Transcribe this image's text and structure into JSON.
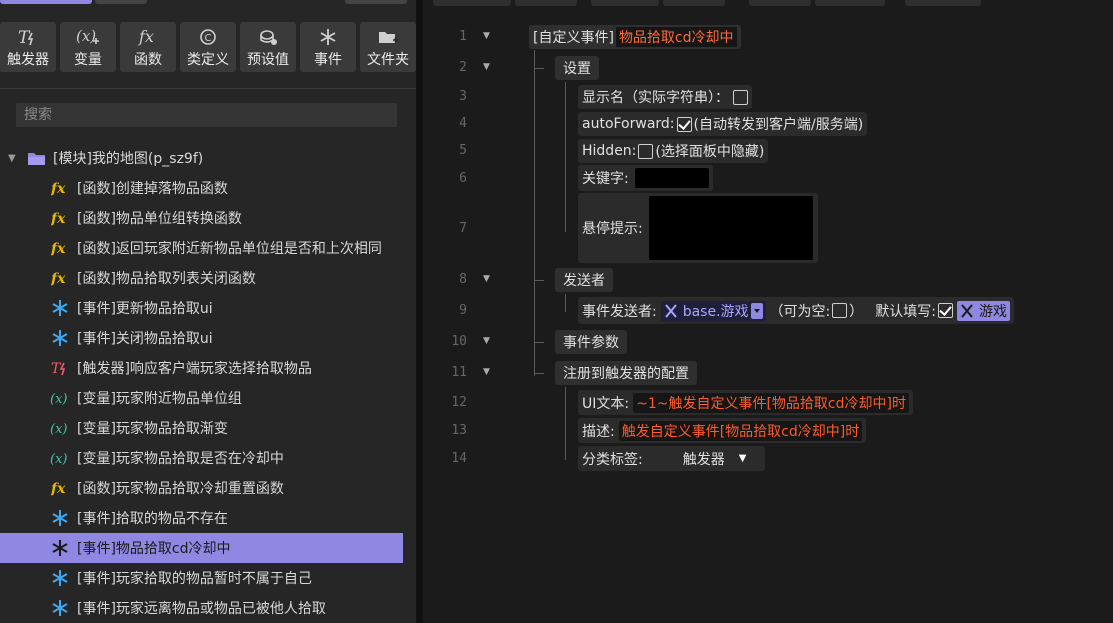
{
  "toolbar": {
    "buttons": [
      {
        "label": "触发器",
        "icon": "trigger-icon"
      },
      {
        "label": "变量",
        "icon": "variable-icon"
      },
      {
        "label": "函数",
        "icon": "function-icon"
      },
      {
        "label": "类定义",
        "icon": "class-icon"
      },
      {
        "label": "预设值",
        "icon": "preset-icon"
      },
      {
        "label": "事件",
        "icon": "event-icon"
      },
      {
        "label": "文件夹",
        "icon": "folder-add-icon"
      }
    ]
  },
  "search": {
    "placeholder": "搜索"
  },
  "tree": {
    "root": "[模块]我的地图(p_sz9f)",
    "items": [
      {
        "label": "[函数]创建掉落物品函数",
        "type": "function"
      },
      {
        "label": "[函数]物品单位组转换函数",
        "type": "function"
      },
      {
        "label": "[函数]返回玩家附近新物品单位组是否和上次相同",
        "type": "function"
      },
      {
        "label": "[函数]物品拾取列表关闭函数",
        "type": "function"
      },
      {
        "label": "[事件]更新物品拾取ui",
        "type": "event"
      },
      {
        "label": "[事件]关闭物品拾取ui",
        "type": "event"
      },
      {
        "label": "[触发器]响应客户端玩家选择拾取物品",
        "type": "trigger"
      },
      {
        "label": "[变量]玩家附近物品单位组",
        "type": "variable"
      },
      {
        "label": "[变量]玩家物品拾取渐变",
        "type": "variable"
      },
      {
        "label": "[变量]玩家物品拾取是否在冷却中",
        "type": "variable"
      },
      {
        "label": "[函数]玩家物品拾取冷却重置函数",
        "type": "function"
      },
      {
        "label": "[事件]拾取的物品不存在",
        "type": "event"
      },
      {
        "label": "[事件]物品拾取cd冷却中",
        "type": "event",
        "selected": true
      },
      {
        "label": "[事件]玩家拾取的物品暂时不属于自己",
        "type": "event"
      },
      {
        "label": "[事件]玩家远离物品或物品已被他人拾取",
        "type": "event"
      }
    ]
  },
  "editor": {
    "line_numbers": [
      "1",
      "2",
      "3",
      "4",
      "5",
      "6",
      "7",
      "8",
      "9",
      "10",
      "11",
      "12",
      "13",
      "14"
    ],
    "header_prefix": "[自定义事件]",
    "header_name": "物品拾取cd冷却中",
    "settings_label": "设置",
    "display_name_label": "显示名（实际字符串）：",
    "auto_forward_label": "autoForward:",
    "auto_forward_desc": "(自动转发到客户端/服务端)",
    "hidden_label": "Hidden:",
    "hidden_desc": "(选择面板中隐藏)",
    "keyword_label": "关键字:",
    "tooltip_label": "悬停提示:",
    "sender_section": "发送者",
    "sender_label": "事件发送者:",
    "sender_value": "base.游戏",
    "nullable_label": "（可为空:",
    "nullable_close": "）",
    "default_fill_label": "默认填写:",
    "default_value": "游戏",
    "params_section": "事件参数",
    "register_section": "注册到触发器的配置",
    "ui_text_label": "UI文本:",
    "ui_text_value": "~1~触发自定义事件[物品拾取cd冷却中]时",
    "desc_label": "描述:",
    "desc_value": "触发自定义事件[物品拾取cd冷却中]时",
    "category_label": "分类标签:",
    "category_value": "触发器"
  },
  "colors": {
    "accent": "#8f87e2",
    "function_icon": "#e6b800",
    "event_icon": "#3da9f5",
    "trigger_icon": "#f05a6b",
    "variable_icon": "#3fc5b5",
    "red_text": "#ff5a2a"
  }
}
